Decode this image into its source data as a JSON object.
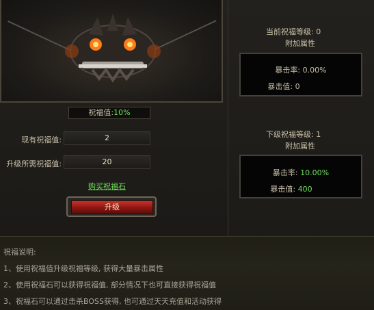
{
  "blessing": {
    "value_label": "祝福值:",
    "value_pct": "10%",
    "current_label": "现有祝福值:",
    "current_value": "2",
    "required_label": "升级所需祝福值:",
    "required_value": "20",
    "buy_link": "购买祝福石",
    "upgrade_button": "升级"
  },
  "current": {
    "level_label": "当前祝福等级: 0",
    "attr_title": "附加属性",
    "crit_rate": "暴击率: 0.00%",
    "crit_value": "暴击值: 0"
  },
  "next": {
    "level_label": "下级祝福等级: 1",
    "attr_title": "附加属性",
    "crit_rate_label": "暴击率: ",
    "crit_rate_value": "10.00%",
    "crit_value_label": "暴击值: ",
    "crit_value_value": "400"
  },
  "description": {
    "title": "祝福说明:",
    "lines": [
      "1、使用祝福值升级祝福等级, 获得大量暴击属性",
      "2、使用祝福石可以获得祝福值, 部分情况下也可直接获得祝福值",
      "3、祝福石可以通过击杀BOSS获得, 也可通过天天充值和活动获得"
    ]
  },
  "icons": {
    "portrait": "demon-skull-icon"
  },
  "colors": {
    "green": "#6fe05a",
    "button_red": "#8c1612"
  }
}
